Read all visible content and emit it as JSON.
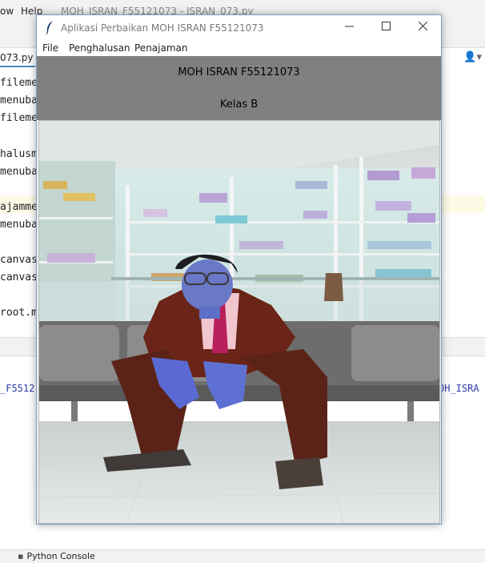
{
  "ide": {
    "menu": {
      "view_partial": "ow",
      "help": "Help"
    },
    "window_title": "MOH_ISRAN_F55121073 - ISRAN_073.py",
    "file_tab": "073.py",
    "code_lines": [
      "filemen",
      "menubar",
      "filemen",
      "halusme",
      "menubar",
      "ajamme",
      "menubar",
      "canvas",
      "canvas",
      "root.ma"
    ],
    "run_left": "_F5512",
    "run_right": "OH_ISRA",
    "console_tab": "Python Console"
  },
  "app": {
    "title": "Aplikasi Perbaikan MOH ISRAN F55121073",
    "menu": [
      "File",
      "Penghalusan",
      "Penajaman"
    ],
    "name_label": "MOH ISRAN F55121073",
    "class_label": "Kelas B",
    "window_buttons": {
      "minimize": "—",
      "maximize": "☐",
      "close": "✕"
    }
  },
  "icons": {
    "feather": "feather-icon",
    "user": "user-icon",
    "console": "python-console-icon"
  }
}
